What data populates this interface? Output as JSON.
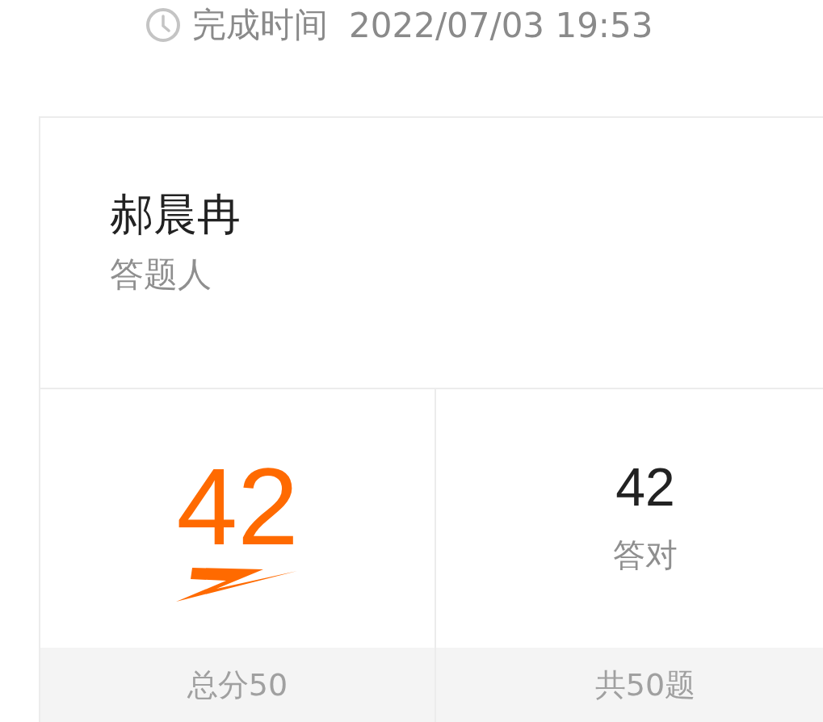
{
  "completion": {
    "label": "完成时间",
    "time": "2022/07/03 19:53"
  },
  "respondent": {
    "name": "郝晨冉",
    "label": "答题人"
  },
  "stats": [
    {
      "kind": "score",
      "value": "42",
      "footer": "总分50"
    },
    {
      "kind": "count",
      "value": "42",
      "caption": "答对",
      "footer": "共50题"
    }
  ]
}
